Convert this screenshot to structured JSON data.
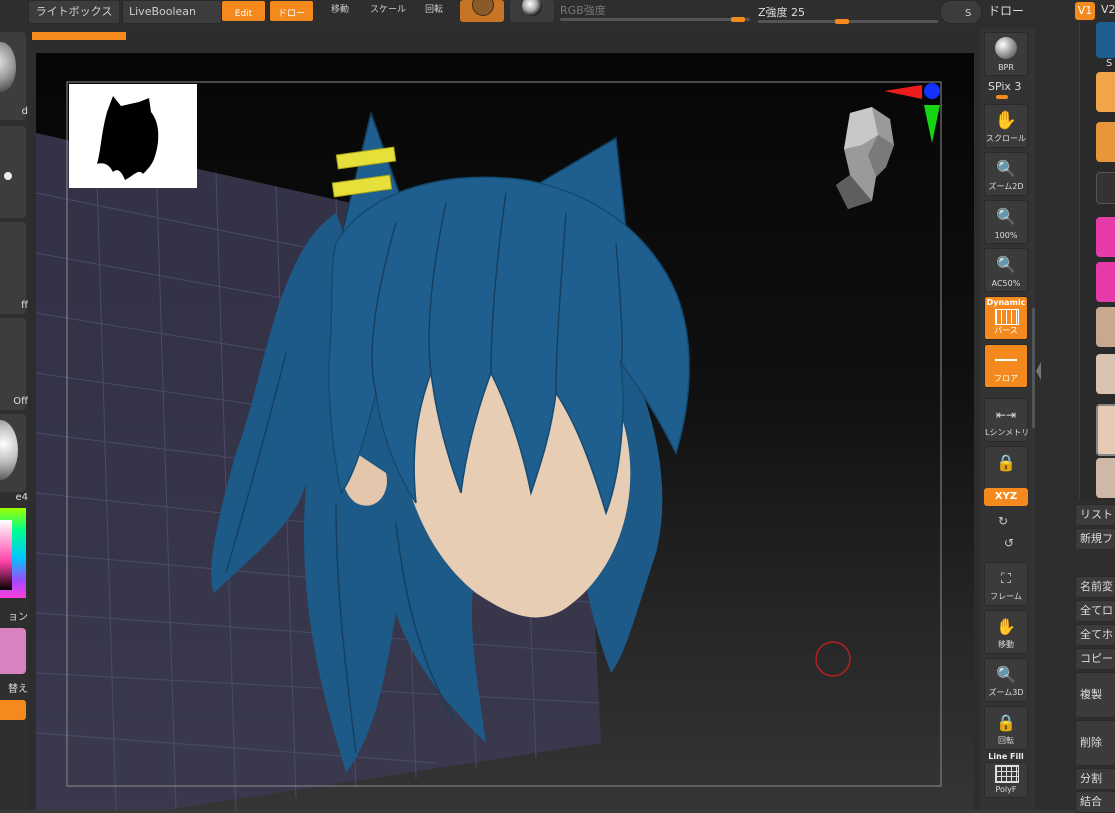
{
  "topbar": {
    "lightbox_label": "ライトボックス",
    "liveboolean_label": "LiveBoolean",
    "edit_label": "Edit",
    "draw_label": "ドロー",
    "move_label": "移動",
    "scale_label": "スケール",
    "rotate_label": "回転",
    "rgb_label": "RGB強度",
    "z_label": "Z強度 25",
    "s_label": "S",
    "draw_menu_label": "ドロー"
  },
  "leftpanel": {
    "item_1": "d",
    "item_2": "ff",
    "item_3": "Off",
    "item_4": "e4",
    "item_5": "ョン",
    "item_6": "替え"
  },
  "righttools": {
    "bpr": "BPR",
    "spix": "SPix 3",
    "scroll": "スクロール",
    "zoom2d": "ズーム2D",
    "pct100": "100%",
    "ac50": "AC50%",
    "dynamic": "Dynamic",
    "perspective": "パース",
    "floor": "フロア",
    "lsym": "Lシンメトリ",
    "xyz": "XYZ",
    "frame": "フレーム",
    "move": "移動",
    "zoom3d": "ズーム3D",
    "rotate": "回転",
    "linefill": "Line Fill",
    "polyf": "PolyF"
  },
  "farright": {
    "v1": "V1",
    "v2": "V2",
    "s_tab": "S",
    "list": "リスト",
    "new": "新規フ",
    "rename": "名前変",
    "all_lo": "全てロ",
    "all_ho": "全てホ",
    "copy": "コピー",
    "dup": "複製",
    "delete": "削除",
    "split": "分割",
    "merge": "結合"
  },
  "colors": {
    "accent": "#f48a1e",
    "hair": "#1f5f8f",
    "skin": "#e8cdb5"
  }
}
